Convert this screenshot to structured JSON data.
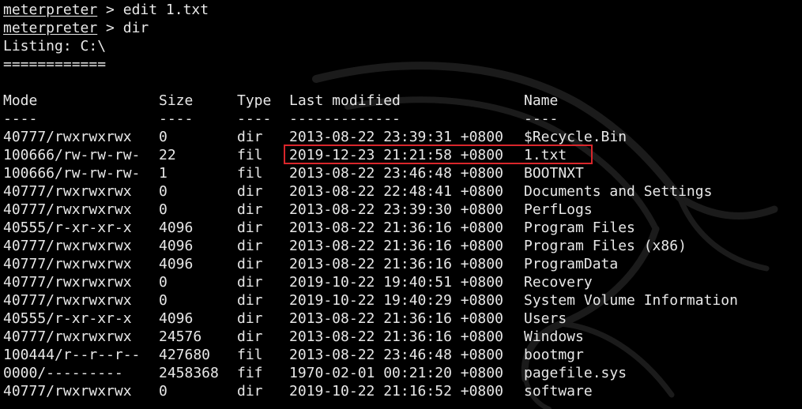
{
  "terminal": {
    "commands": [
      {
        "prompt": "meterpreter",
        "separator": " > ",
        "command": "edit 1.txt"
      },
      {
        "prompt": "meterpreter",
        "separator": " > ",
        "command": "dir"
      }
    ],
    "listing_title": "Listing: C:\\",
    "listing_rule": "============",
    "table": {
      "headers": {
        "mode": "Mode",
        "size": "Size",
        "type": "Type",
        "last_modified": "Last modified",
        "name": "Name"
      },
      "dividers": {
        "mode": "----",
        "size": "----",
        "type": "----",
        "last_modified": "-------------",
        "name": "----"
      },
      "rows": [
        {
          "mode": "40777/rwxrwxrwx",
          "size": "0",
          "type": "dir",
          "last_modified": "2013-08-22 23:39:31 +0800",
          "name": "$Recycle.Bin"
        },
        {
          "mode": "100666/rw-rw-rw-",
          "size": "22",
          "type": "fil",
          "last_modified": "2019-12-23 21:21:58 +0800",
          "name": "1.txt"
        },
        {
          "mode": "100666/rw-rw-rw-",
          "size": "1",
          "type": "fil",
          "last_modified": "2013-08-22 23:46:48 +0800",
          "name": "BOOTNXT"
        },
        {
          "mode": "40777/rwxrwxrwx",
          "size": "0",
          "type": "dir",
          "last_modified": "2013-08-22 22:48:41 +0800",
          "name": "Documents and Settings"
        },
        {
          "mode": "40777/rwxrwxrwx",
          "size": "0",
          "type": "dir",
          "last_modified": "2013-08-22 23:39:30 +0800",
          "name": "PerfLogs"
        },
        {
          "mode": "40555/r-xr-xr-x",
          "size": "4096",
          "type": "dir",
          "last_modified": "2013-08-22 21:36:16 +0800",
          "name": "Program Files"
        },
        {
          "mode": "40777/rwxrwxrwx",
          "size": "4096",
          "type": "dir",
          "last_modified": "2013-08-22 21:36:16 +0800",
          "name": "Program Files (x86)"
        },
        {
          "mode": "40777/rwxrwxrwx",
          "size": "4096",
          "type": "dir",
          "last_modified": "2013-08-22 21:36:16 +0800",
          "name": "ProgramData"
        },
        {
          "mode": "40777/rwxrwxrwx",
          "size": "0",
          "type": "dir",
          "last_modified": "2019-10-22 19:40:51 +0800",
          "name": "Recovery"
        },
        {
          "mode": "40777/rwxrwxrwx",
          "size": "0",
          "type": "dir",
          "last_modified": "2019-10-22 19:40:29 +0800",
          "name": "System Volume Information"
        },
        {
          "mode": "40555/r-xr-xr-x",
          "size": "4096",
          "type": "dir",
          "last_modified": "2013-08-22 21:36:16 +0800",
          "name": "Users"
        },
        {
          "mode": "40777/rwxrwxrwx",
          "size": "24576",
          "type": "dir",
          "last_modified": "2013-08-22 21:36:16 +0800",
          "name": "Windows"
        },
        {
          "mode": "100444/r--r--r--",
          "size": "427680",
          "type": "fil",
          "last_modified": "2013-08-22 23:46:48 +0800",
          "name": "bootmgr"
        },
        {
          "mode": "0000/---------",
          "size": "2458368",
          "type": "fif",
          "last_modified": "1970-02-01 00:21:20 +0800",
          "name": "pagefile.sys"
        },
        {
          "mode": "40777/rwxrwxrwx",
          "size": "0",
          "type": "dir",
          "last_modified": "2019-10-22 21:16:52 +0800",
          "name": "software"
        }
      ]
    },
    "highlighted_row_index": 1
  },
  "colors": {
    "background": "#000000",
    "text": "#e8e8e8",
    "highlight_border": "#d9262b",
    "watermark": "#1c1c1c"
  },
  "icons": {
    "background_watermark": "kali-dragon-icon"
  }
}
